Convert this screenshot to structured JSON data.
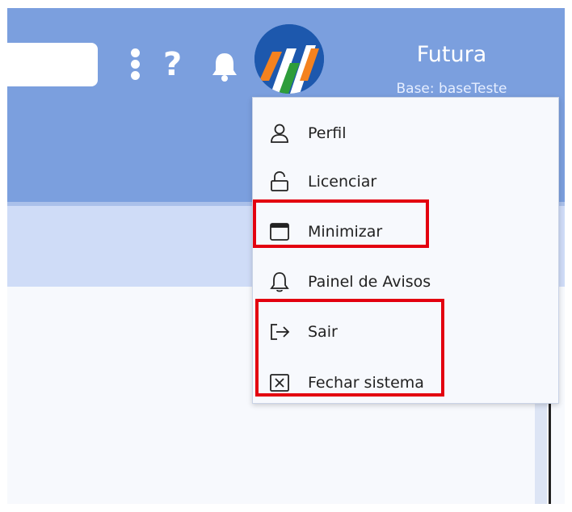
{
  "header": {
    "user_name": "Futura",
    "base_label": "Base: baseTeste"
  },
  "icons": {
    "more": "kebab-vertical-icon",
    "help": "help-icon",
    "notifications": "bell-icon",
    "avatar": "futura-logo-avatar"
  },
  "help_glyph": "?",
  "menu": {
    "items": [
      {
        "label": "Perfil",
        "icon": "user-icon"
      },
      {
        "label": "Licenciar",
        "icon": "unlock-icon"
      },
      {
        "label": "Minimizar",
        "icon": "window-icon"
      },
      {
        "label": "Painel de Avisos",
        "icon": "bell-outline-icon"
      },
      {
        "label": "Sair",
        "icon": "logout-icon"
      },
      {
        "label": "Fechar sistema",
        "icon": "close-box-icon"
      }
    ]
  },
  "colors": {
    "header": "#7b9fde",
    "highlight": "#e3000f",
    "menu_bg": "#f7f9fd"
  }
}
